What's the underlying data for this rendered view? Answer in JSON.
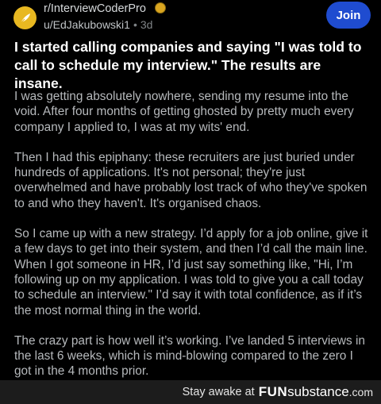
{
  "header": {
    "subreddit": "r/InterviewCoderPro",
    "username": "u/EdJakubowski1",
    "separator": "•",
    "time": "3d",
    "join_label": "Join"
  },
  "post": {
    "title": "I started calling companies and saying \"I was told to call to schedule my interview.\" The results are insane.",
    "paragraphs": [
      "I was getting absolutely nowhere, sending my resume into the void. After four months of getting ghosted by pretty much every company I applied to, I was at my wits' end.",
      "Then I had this epiphany: these recruiters are just buried under hundreds of applications. It's not personal; they're just overwhelmed and have probably lost track of who they've spoken to and who they haven't. It's organised chaos.",
      "So I came up with a new strategy. I’d apply for a job online, give it a few days to get into their system, and then I’d call the main line. When I got someone in HR, I’d just say something like, \"Hi, I’m following up on my application. I was told to give you a call today to schedule an interview.\" I’d say it with total confidence, as if it’s the most normal thing in the world.",
      "The crazy part is how well it’s working. I’ve landed 5 interviews in the last 6 weeks, which is mind-blowing compared to the zero I got in the 4 months prior."
    ]
  },
  "watermark": {
    "stay_text": "Stay awake at",
    "brand_fun": "FUN",
    "brand_substance": "substance",
    "brand_tld": ".com"
  },
  "colors": {
    "background": "#000000",
    "join_button": "#1f4cd0",
    "subreddit_icon": "#e8b821"
  },
  "icons": [
    "subreddit-icon",
    "award-icon"
  ]
}
